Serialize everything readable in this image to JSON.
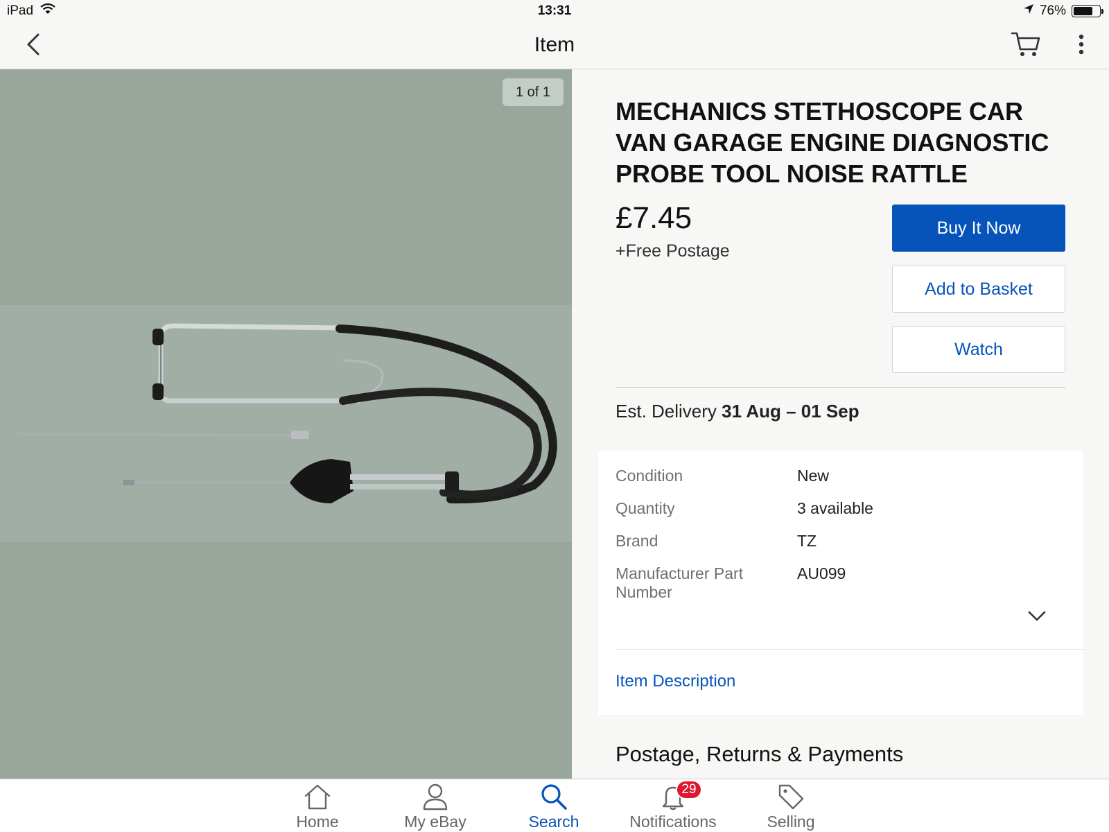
{
  "status_bar": {
    "device": "iPad",
    "time": "13:31",
    "battery_text": "76%",
    "battery_level": 0.76
  },
  "nav": {
    "title": "Item",
    "back_icon": "chevron-left-icon",
    "cart_icon": "cart-icon",
    "more_icon": "more-vertical-icon"
  },
  "gallery": {
    "counter": "1 of 1"
  },
  "item": {
    "title": "MECHANICS STETHOSCOPE CAR VAN GARAGE ENGINE DIAGNOSTIC PROBE TOOL NOISE RATTLE",
    "price": "£7.45",
    "postage": "+Free Postage"
  },
  "actions": {
    "buy_now": "Buy It Now",
    "add_to_basket": "Add to Basket",
    "watch": "Watch"
  },
  "delivery": {
    "label": "Est. Delivery",
    "dates": "31 Aug – 01 Sep"
  },
  "specifics": [
    {
      "label": "Condition",
      "value": "New"
    },
    {
      "label": "Quantity",
      "value": "3 available"
    },
    {
      "label": "Brand",
      "value": "TZ"
    },
    {
      "label": "Manufacturer Part Number",
      "value": "AU099"
    }
  ],
  "description_link": "Item Description",
  "section_heading": "Postage, Returns & Payments",
  "tabs": [
    {
      "label": "Home",
      "icon": "home-icon"
    },
    {
      "label": "My eBay",
      "icon": "user-icon"
    },
    {
      "label": "Search",
      "icon": "search-icon",
      "active": true
    },
    {
      "label": "Notifications",
      "icon": "bell-icon",
      "badge": "29"
    },
    {
      "label": "Selling",
      "icon": "tag-icon"
    }
  ],
  "colors": {
    "accent": "#0654ba",
    "badge": "#e0182d",
    "image_background": "#98a69b"
  }
}
